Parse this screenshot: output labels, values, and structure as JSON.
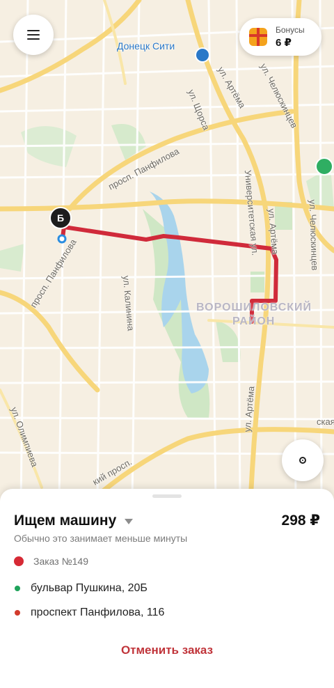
{
  "map": {
    "poi_name": "Донецк Сити",
    "street_labels": [
      {
        "text": "ул. Артёма"
      },
      {
        "text": "ул. Челюскинцев"
      },
      {
        "text": "ул. Щорса"
      },
      {
        "text": "просп. Панфилова"
      },
      {
        "text": "Университетская ул."
      },
      {
        "text": "ул. Артёма"
      },
      {
        "text": "ул. Челюскинцев"
      },
      {
        "text": "просп. Панфилова"
      },
      {
        "text": "ул. Калинина"
      },
      {
        "text": "ул. Артёма"
      },
      {
        "text": "ул. Олимпиева"
      },
      {
        "text": "кий просп."
      },
      {
        "text": "ская ул."
      }
    ],
    "district_line1": "ВОРОШИЛОВСКИЙ",
    "district_line2": "РАЙОН",
    "marker_letter": "Б",
    "route_color": "#d02a3a"
  },
  "menu_button": {
    "icon": "hamburger-menu-icon"
  },
  "bonus": {
    "title": "Бонусы",
    "value": "6 ₽",
    "icon": "gift-icon"
  },
  "locate_button": {
    "icon": "locate-icon"
  },
  "sheet": {
    "status_title": "Ищем машину",
    "price": "298 ₽",
    "subtitle": "Обычно это занимает меньше минуты",
    "order_label": "Заказ №149",
    "addresses": [
      {
        "text": "бульвар Пушкина, 20Б",
        "color": "#1fa35b"
      },
      {
        "text": "проспект Панфилова, 116",
        "color": "#d23b2c"
      }
    ],
    "cancel_label": "Отменить заказ"
  }
}
